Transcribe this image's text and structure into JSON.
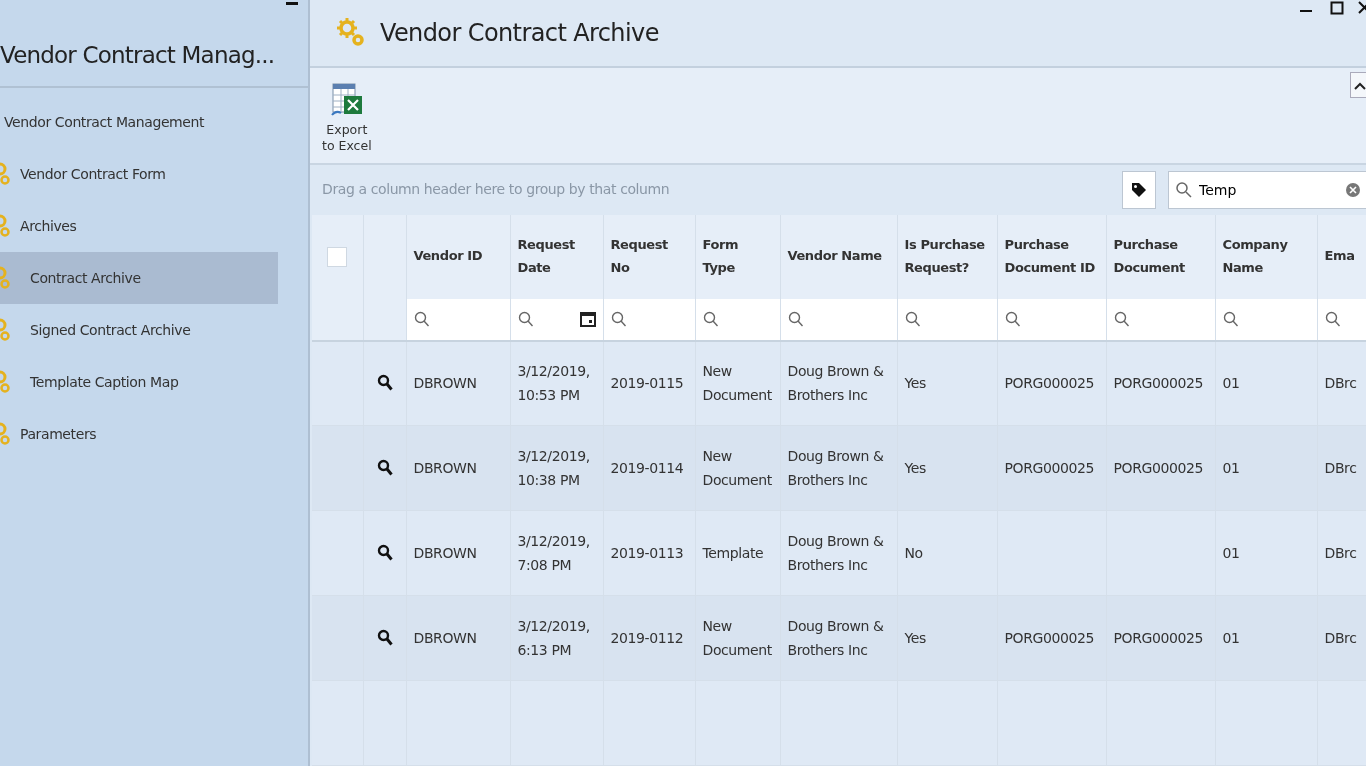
{
  "sidebar": {
    "title": "Vendor Contract Manag...",
    "items": [
      {
        "label": "Vendor Contract Management",
        "selected": false,
        "children": [
          {
            "label": "Vendor Contract Form",
            "selected": false
          },
          {
            "label": "Archives",
            "selected": false,
            "children": [
              {
                "label": "Contract Archive",
                "selected": true
              },
              {
                "label": "Signed Contract Archive",
                "selected": false
              },
              {
                "label": "Template Caption Map",
                "selected": false
              }
            ]
          },
          {
            "label": "Parameters",
            "selected": false
          }
        ]
      }
    ]
  },
  "header": {
    "title": "Vendor Contract Archive"
  },
  "toolbar": {
    "buttons": [
      {
        "label": "Export\nto Excel"
      }
    ]
  },
  "group_panel": {
    "hint": "Drag a column header here to group by that column"
  },
  "search": {
    "value": "Temp"
  },
  "table": {
    "select_all": {
      "checked": false
    },
    "columns": [
      {
        "label": "Vendor ID"
      },
      {
        "label": "Request Date",
        "kind": "date"
      },
      {
        "label": "Request No"
      },
      {
        "label": "Form Type"
      },
      {
        "label": "Vendor Name"
      },
      {
        "label": "Is Purchase Request?"
      },
      {
        "label": "Purchase Document ID"
      },
      {
        "label": "Purchase Document"
      },
      {
        "label": "Company Name"
      },
      {
        "label": "Ema"
      }
    ],
    "rows": [
      {
        "cells": [
          "DBROWN",
          "3/12/2019, 10:53 PM",
          "2019-0115",
          "New Document",
          "Doug Brown & Brothers Inc",
          "Yes",
          "PORG000025",
          "PORG000025",
          "01",
          "DBrc"
        ]
      },
      {
        "cells": [
          "DBROWN",
          "3/12/2019, 10:38 PM",
          "2019-0114",
          "New Document",
          "Doug Brown & Brothers Inc",
          "Yes",
          "PORG000025",
          "PORG000025",
          "01",
          "DBrc"
        ]
      },
      {
        "cells": [
          "DBROWN",
          "3/12/2019, 7:08 PM",
          "2019-0113",
          "Template",
          "Doug Brown & Brothers Inc",
          "No",
          "",
          "",
          "01",
          "DBrc"
        ]
      },
      {
        "cells": [
          "DBROWN",
          "3/12/2019, 6:13 PM",
          "2019-0112",
          "New Document",
          "Doug Brown & Brothers Inc",
          "Yes",
          "PORG000025",
          "PORG000025",
          "01",
          "DBrc"
        ]
      }
    ]
  }
}
